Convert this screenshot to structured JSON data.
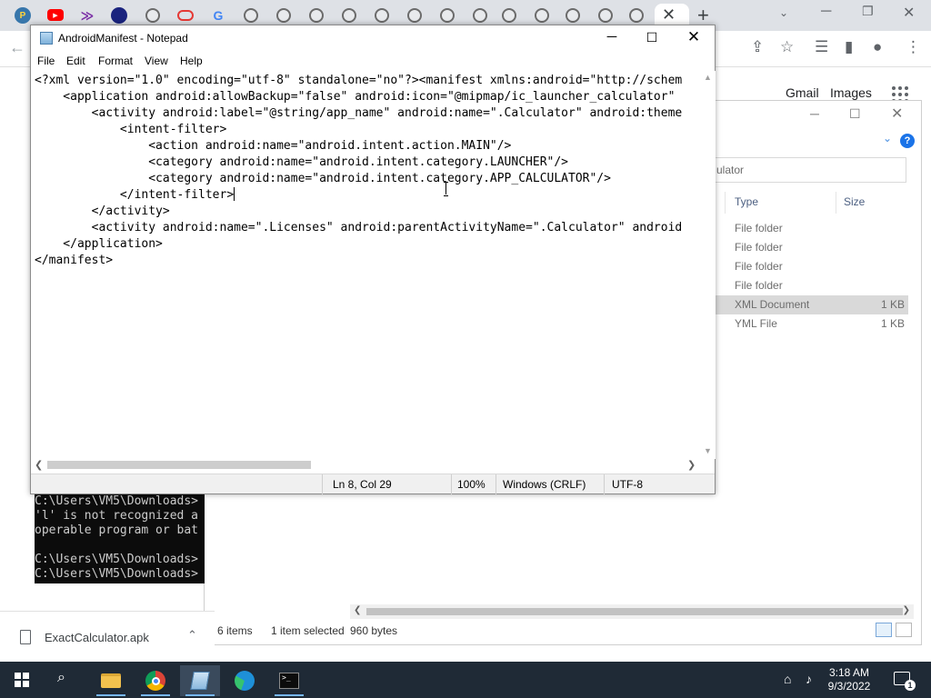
{
  "browser": {
    "google_links": [
      "Gmail",
      "Images"
    ],
    "download": {
      "filename": "ExactCalculator.apk"
    }
  },
  "explorer": {
    "search_text": "ulator",
    "columns": [
      "Type",
      "Size"
    ],
    "rows": [
      {
        "type": "File folder",
        "size": ""
      },
      {
        "type": "File folder",
        "size": ""
      },
      {
        "type": "File folder",
        "size": ""
      },
      {
        "type": "File folder",
        "size": ""
      },
      {
        "type": "XML Document",
        "size": "1 KB",
        "selected": true
      },
      {
        "type": "YML File",
        "size": "1 KB"
      }
    ],
    "status": {
      "items": "6 items",
      "selected": "1 item selected",
      "bytes": "960 bytes"
    }
  },
  "cmd": {
    "lines": [
      "C:\\Users\\VM5\\Downloads>",
      "'l' is not recognized a",
      "operable program or bat",
      "",
      "C:\\Users\\VM5\\Downloads>",
      "C:\\Users\\VM5\\Downloads>"
    ]
  },
  "notepad": {
    "title": "AndroidManifest - Notepad",
    "menu": [
      "File",
      "Edit",
      "Format",
      "View",
      "Help"
    ],
    "lines": [
      "<?xml version=\"1.0\" encoding=\"utf-8\" standalone=\"no\"?><manifest xmlns:android=\"http://schem",
      "    <application android:allowBackup=\"false\" android:icon=\"@mipmap/ic_launcher_calculator\"",
      "        <activity android:label=\"@string/app_name\" android:name=\".Calculator\" android:theme",
      "            <intent-filter>",
      "                <action android:name=\"android.intent.action.MAIN\"/>",
      "                <category android:name=\"android.intent.category.LAUNCHER\"/>",
      "                <category android:name=\"android.intent.category.APP_CALCULATOR\"/>",
      "            </intent-filter>",
      "        </activity>",
      "        <activity android:name=\".Licenses\" android:parentActivityName=\".Calculator\" android",
      "    </application>",
      "</manifest>"
    ],
    "caret_line": 7,
    "status": {
      "position": "Ln 8, Col 29",
      "zoom": "100%",
      "line_ending": "Windows (CRLF)",
      "encoding": "UTF-8"
    }
  },
  "taskbar": {
    "apps": [
      "file-explorer",
      "chrome",
      "notepad",
      "edge",
      "command-prompt"
    ],
    "active_app": "notepad",
    "clock": {
      "time": "3:18 AM",
      "date": "9/3/2022"
    },
    "notification_count": "1"
  }
}
